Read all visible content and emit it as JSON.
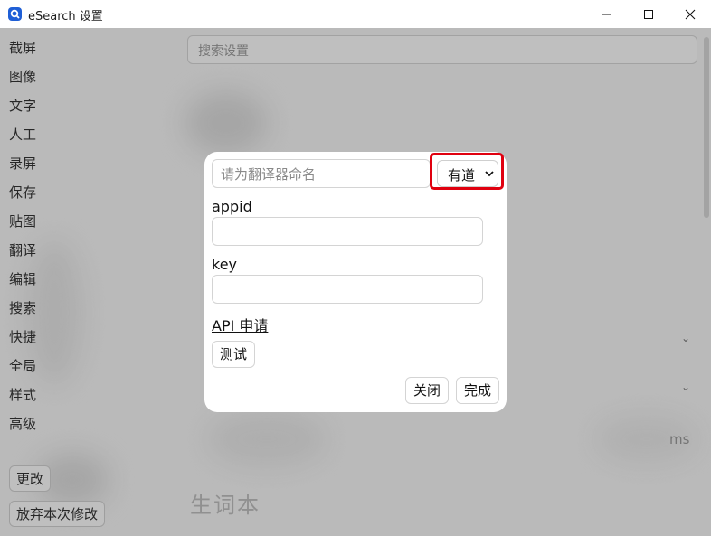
{
  "window": {
    "title": "eSearch 设置",
    "icons": [
      "app-logo-icon",
      "minimize-icon",
      "maximize-icon",
      "close-icon"
    ]
  },
  "sidebar": {
    "items": [
      {
        "label": "截屏"
      },
      {
        "label": "图像"
      },
      {
        "label": "文字"
      },
      {
        "label": "人工"
      },
      {
        "label": "录屏"
      },
      {
        "label": "保存"
      },
      {
        "label": "贴图"
      },
      {
        "label": "翻译"
      },
      {
        "label": "编辑"
      },
      {
        "label": "搜索"
      },
      {
        "label": "快捷"
      },
      {
        "label": "全局"
      },
      {
        "label": "样式"
      },
      {
        "label": "高级"
      }
    ],
    "change_button": "更改",
    "discard_button": "放弃本次修改"
  },
  "main": {
    "search_placeholder": "搜索设置",
    "unit_text": "ms",
    "vocab_heading": "生词本"
  },
  "dialog": {
    "name_placeholder": "请为翻译器命名",
    "engine_select": {
      "selected": "有道"
    },
    "fields": [
      {
        "label": "appid",
        "value": ""
      },
      {
        "label": "key",
        "value": ""
      }
    ],
    "api_link": "API 申请",
    "test_button": "测试",
    "close_button": "关闭",
    "done_button": "完成"
  },
  "colors": {
    "highlight_border": "#e0000f",
    "app_icon": "#1f5fd6",
    "overlay": "rgba(0,0,0,0.235)"
  }
}
